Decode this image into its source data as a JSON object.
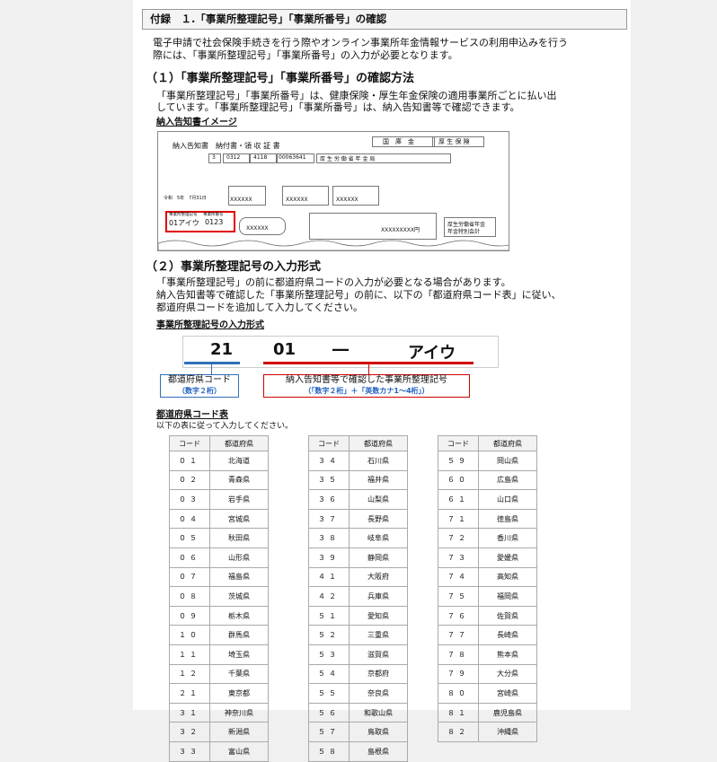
{
  "header": {
    "title": "付録　１.「事業所整理記号」「事業所番号」の確認"
  },
  "intro": [
    "電子申請で社会保険手続きを行う際やオンライン事業所年金情報サービスの利用申込みを行う",
    "際には、「事業所整理記号」「事業所番号」の入力が必要となります。"
  ],
  "section1": {
    "title": "（１）「事業所整理記号」「事業所番号」の確認方法",
    "body": [
      "「事業所整理記号」「事業所番号」は、健康保険・厚生年金保険の適用事業所ごとに払い出",
      "しています。「事業所整理記号」「事業所番号」は、納入告知書等で確認できます。"
    ],
    "image_caption": "納入告知書イメージ"
  },
  "receipt": {
    "title": "納入告知書　納付書・領 収 証 書",
    "kokko": "国　庫　金",
    "hoken": "厚 生 保 険",
    "codes": [
      "3",
      "0312",
      "4118",
      "00063641"
    ],
    "payee": "厚 生 労 働 省 年 金 局",
    "mask1": "XXXXXX",
    "mask2": "XXXXXX",
    "mask3": "XXXXXX",
    "mask4": "XXXXXX",
    "total": "XXXXXXXXX円",
    "seiri_label": "事業所整理記号",
    "bango_label": "事業所番号",
    "seiri": "01アイウ",
    "bango": "0123",
    "date": "令和　5年　7月31日",
    "office": "厚生労働省年金",
    "office2": "年金特別会計"
  },
  "section2": {
    "title": "（２）事業所整理記号の入力形式",
    "body": [
      "「事業所整理記号」の前に都道府県コードの入力が必要となる場合があります。",
      "納入告知書等で確認した「事業所整理記号」の前に、以下の「都道府県コード表」に従い、",
      "都道府県コードを追加して入力してください。"
    ],
    "format_caption": "事業所整理記号の入力形式",
    "format": {
      "pref": "21",
      "code": "01",
      "dash": "―",
      "kana": "アイウ"
    },
    "label_pref": "都道府県コード",
    "label_pref_sub": "（数字２桁）",
    "label_code": "納入告知書等で確認した事業所整理記号",
    "label_code_sub": "（「数字２桁」＋「英数カナ1～4桁」）",
    "table_caption": "都道府県コード表",
    "table_note": "以下の表に従って入力してください。"
  },
  "table": {
    "headers": [
      "コード",
      "都道府県"
    ],
    "col1": [
      [
        "０１",
        "北海道"
      ],
      [
        "０２",
        "青森県"
      ],
      [
        "０３",
        "岩手県"
      ],
      [
        "０４",
        "宮城県"
      ],
      [
        "０５",
        "秋田県"
      ],
      [
        "０６",
        "山形県"
      ],
      [
        "０７",
        "福島県"
      ],
      [
        "０８",
        "茨城県"
      ],
      [
        "０９",
        "栃木県"
      ],
      [
        "１０",
        "群馬県"
      ],
      [
        "１１",
        "埼玉県"
      ],
      [
        "１２",
        "千葉県"
      ],
      [
        "２１",
        "東京都"
      ],
      [
        "３１",
        "神奈川県"
      ],
      [
        "３２",
        "新潟県"
      ],
      [
        "３３",
        "富山県"
      ]
    ],
    "col2": [
      [
        "３４",
        "石川県"
      ],
      [
        "３５",
        "福井県"
      ],
      [
        "３６",
        "山梨県"
      ],
      [
        "３７",
        "長野県"
      ],
      [
        "３８",
        "岐阜県"
      ],
      [
        "３９",
        "静岡県"
      ],
      [
        "４１",
        "大阪府"
      ],
      [
        "４２",
        "兵庫県"
      ],
      [
        "５１",
        "愛知県"
      ],
      [
        "５２",
        "三重県"
      ],
      [
        "５３",
        "滋賀県"
      ],
      [
        "５４",
        "京都府"
      ],
      [
        "５５",
        "奈良県"
      ],
      [
        "５６",
        "和歌山県"
      ],
      [
        "５７",
        "鳥取県"
      ],
      [
        "５８",
        "島根県"
      ]
    ],
    "col3": [
      [
        "５９",
        "岡山県"
      ],
      [
        "６０",
        "広島県"
      ],
      [
        "６１",
        "山口県"
      ],
      [
        "７１",
        "徳島県"
      ],
      [
        "７２",
        "香川県"
      ],
      [
        "７３",
        "愛媛県"
      ],
      [
        "７４",
        "高知県"
      ],
      [
        "７５",
        "福岡県"
      ],
      [
        "７６",
        "佐賀県"
      ],
      [
        "７７",
        "長崎県"
      ],
      [
        "７８",
        "熊本県"
      ],
      [
        "７９",
        "大分県"
      ],
      [
        "８０",
        "宮崎県"
      ],
      [
        "８１",
        "鹿児島県"
      ],
      [
        "８２",
        "沖縄県"
      ]
    ]
  }
}
